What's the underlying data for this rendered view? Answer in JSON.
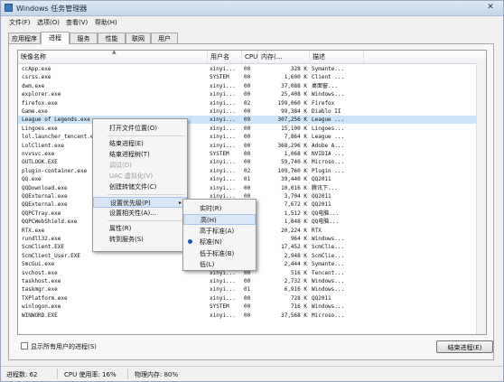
{
  "window": {
    "title": "Windows 任务管理器",
    "close_glyph": "✕"
  },
  "menu": [
    "文件(F)",
    "选项(O)",
    "查看(V)",
    "帮助(H)"
  ],
  "tabs": [
    "应用程序",
    "进程",
    "服务",
    "性能",
    "联网",
    "用户"
  ],
  "columns": [
    "映像名称",
    "用户名",
    "CPU",
    "内存(...",
    "描述"
  ],
  "processes": [
    {
      "name": "ccApp.exe",
      "user": "xinyi...",
      "cpu": "00",
      "mem": "328 K",
      "desc": "Symante..."
    },
    {
      "name": "csrss.exe",
      "user": "SYSTEM",
      "cpu": "00",
      "mem": "1,600 K",
      "desc": "Client ..."
    },
    {
      "name": "dwm.exe",
      "user": "xinyi...",
      "cpu": "00",
      "mem": "37,088 K",
      "desc": "桌面窗..."
    },
    {
      "name": "explorer.exe",
      "user": "xinyi...",
      "cpu": "00",
      "mem": "25,408 K",
      "desc": "Windows..."
    },
    {
      "name": "firefox.exe",
      "user": "xinyi...",
      "cpu": "02",
      "mem": "199,060 K",
      "desc": "Firefox"
    },
    {
      "name": "Game.exe",
      "user": "xinyi...",
      "cpu": "00",
      "mem": "99,384 K",
      "desc": "Diablo II"
    },
    {
      "name": "League of Legends.exe",
      "user": "xinyi...",
      "cpu": "09",
      "mem": "307,256 K",
      "desc": "League ..."
    },
    {
      "name": "Lingoes.exe",
      "user": "xinyi...",
      "cpu": "00",
      "mem": "15,100 K",
      "desc": "Lingoes..."
    },
    {
      "name": "lol.launcher_tencent.exe",
      "user": "xinyi...",
      "cpu": "00",
      "mem": "7,864 K",
      "desc": "League ..."
    },
    {
      "name": "LolClient.exe",
      "user": "xinyi...",
      "cpu": "00",
      "mem": "368,296 K",
      "desc": "Adobe A..."
    },
    {
      "name": "nvvsvc.exe",
      "user": "SYSTEM",
      "cpu": "00",
      "mem": "1,068 K",
      "desc": "NVIDIA ..."
    },
    {
      "name": "OUTLOOK.EXE",
      "user": "xinyi...",
      "cpu": "00",
      "mem": "59,740 K",
      "desc": "Microso..."
    },
    {
      "name": "plugin-container.exe",
      "user": "xinyi...",
      "cpu": "02",
      "mem": "109,760 K",
      "desc": "Plugin ..."
    },
    {
      "name": "QQ.exe",
      "user": "xinyi...",
      "cpu": "01",
      "mem": "39,440 K",
      "desc": "QQ2011"
    },
    {
      "name": "QQDownload.exe",
      "user": "xinyi...",
      "cpu": "00",
      "mem": "10,016 K",
      "desc": "腾讯下..."
    },
    {
      "name": "QQExternal.exe",
      "user": "xinyi...",
      "cpu": "00",
      "mem": "3,704 K",
      "desc": "QQ2011"
    },
    {
      "name": "QQExternal.exe",
      "user": "xinyi...",
      "cpu": "00",
      "mem": "7,672 K",
      "desc": "QQ2011"
    },
    {
      "name": "QQPCTray.exe",
      "user": "xinyi...",
      "cpu": "00",
      "mem": "1,512 K",
      "desc": "QQ电脑..."
    },
    {
      "name": "QQPCWebShield.exe",
      "user": "xinyi...",
      "cpu": "00",
      "mem": "1,848 K",
      "desc": "QQ电脑..."
    },
    {
      "name": "RTX.exe",
      "user": "xinyi...",
      "cpu": "00",
      "mem": "20,224 K",
      "desc": "RTX"
    },
    {
      "name": "rundll32.exe",
      "user": "xinyi...",
      "cpu": "00",
      "mem": "964 K",
      "desc": "Windows..."
    },
    {
      "name": "ScmClient.EXE",
      "user": "xinyi...",
      "cpu": "00",
      "mem": "17,452 K",
      "desc": "ScmClie..."
    },
    {
      "name": "ScmClient_User.EXE",
      "user": "xinyi...",
      "cpu": "00",
      "mem": "2,948 K",
      "desc": "ScmClie..."
    },
    {
      "name": "SmcGui.exe",
      "user": "xinyi...",
      "cpu": "00",
      "mem": "2,444 K",
      "desc": "Symante..."
    },
    {
      "name": "svchost.exe",
      "user": "xinyi...",
      "cpu": "00",
      "mem": "516 K",
      "desc": "Tencent..."
    },
    {
      "name": "taskhost.exe",
      "user": "xinyi...",
      "cpu": "00",
      "mem": "2,732 K",
      "desc": "Windows..."
    },
    {
      "name": "taskmgr.exe",
      "user": "xinyi...",
      "cpu": "01",
      "mem": "6,916 K",
      "desc": "Windows..."
    },
    {
      "name": "TXPlatform.exe",
      "user": "xinyi...",
      "cpu": "00",
      "mem": "728 K",
      "desc": "QQ2011"
    },
    {
      "name": "winlogon.exe",
      "user": "SYSTEM",
      "cpu": "00",
      "mem": "716 K",
      "desc": "Windows..."
    },
    {
      "name": "WINWORD.EXE",
      "user": "xinyi...",
      "cpu": "00",
      "mem": "37,568 K",
      "desc": "Microso..."
    }
  ],
  "selected_index": 6,
  "context_menu": [
    {
      "label": "打开文件位置(O)",
      "disabled": false
    },
    {
      "label": "结束进程(E)",
      "disabled": false
    },
    {
      "label": "结束进程树(T)",
      "disabled": false
    },
    {
      "label": "调试(D)",
      "disabled": true
    },
    {
      "label": "UAC 虚拟化(V)",
      "disabled": true
    },
    {
      "label": "创建转储文件(C)",
      "disabled": false
    },
    {
      "label": "设置优先级(P)",
      "disabled": false,
      "submenu": true,
      "arrow": "▸"
    },
    {
      "label": "设置相关性(A)...",
      "disabled": false
    },
    {
      "label": "属性(R)",
      "disabled": false
    },
    {
      "label": "转到服务(S)",
      "disabled": false
    }
  ],
  "priority_submenu": [
    {
      "label": "实时(R)"
    },
    {
      "label": "高(H)"
    },
    {
      "label": "高于标准(A)"
    },
    {
      "label": "标准(N)"
    },
    {
      "label": "低于标准(B)"
    },
    {
      "label": "低(L)"
    }
  ],
  "priority_checked_index": 3,
  "priority_hover_index": 1,
  "show_all_label": "显示所有用户的进程(S)",
  "end_process_button": "结束进程(E)",
  "status": {
    "processes": "进程数: 62",
    "cpu": "CPU 使用率: 16%",
    "memory": "物理内存: 80%"
  },
  "colors": {
    "selection": "#cce4f7",
    "menu_highlight": "#d9e6f5",
    "radio_bullet": "#1f58b6"
  },
  "icons": [
    "app-icon",
    "close-icon",
    "sort-up-icon",
    "submenu-arrow-icon",
    "radio-bullet-icon"
  ]
}
